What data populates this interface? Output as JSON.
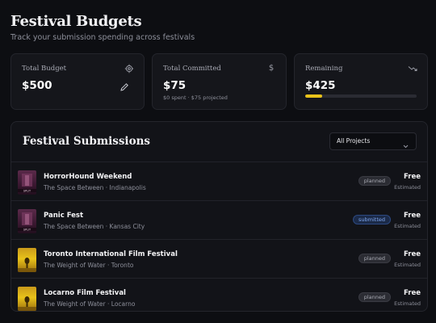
{
  "header": {
    "title": "Festival Budgets",
    "subtitle": "Track your submission spending across festivals"
  },
  "cards": {
    "total_budget": {
      "label": "Total Budget",
      "value": "$500",
      "icon": "settings-gear-icon",
      "action_icon": "pencil-edit-icon"
    },
    "total_committed": {
      "label": "Total Committed",
      "value": "$75",
      "icon": "dollar-icon",
      "sub": "$0 spent · $75 projected"
    },
    "remaining": {
      "label": "Remaining",
      "value": "$425",
      "icon": "trend-down-icon",
      "progress": 0.15,
      "progress_color": "#e8c21a"
    }
  },
  "submissions": {
    "title": "Festival Submissions",
    "filter": {
      "selected": "All Projects"
    },
    "rows": [
      {
        "title": "HorrorHound Weekend",
        "subtitle": "The Space Between · Indianapolis",
        "status": "planned",
        "price": "Free",
        "price_note": "Estimated",
        "poster_label": "SPLIT"
      },
      {
        "title": "Panic Fest",
        "subtitle": "The Space Between · Kansas City",
        "status": "submitted",
        "price": "Free",
        "price_note": "Estimated",
        "poster_label": "SPLIT"
      },
      {
        "title": "Toronto International Film Festival",
        "subtitle": "The Weight of Water · Toronto",
        "status": "planned",
        "price": "Free",
        "price_note": "Estimated",
        "poster_label": ""
      },
      {
        "title": "Locarno Film Festival",
        "subtitle": "The Weight of Water · Locarno",
        "status": "planned",
        "price": "Free",
        "price_note": "Estimated",
        "poster_label": ""
      }
    ]
  },
  "colors": {
    "background": "#0d0e12",
    "card": "#15161b",
    "accent_yellow": "#e8c21a",
    "submitted_blue": "#7ea6ee"
  }
}
